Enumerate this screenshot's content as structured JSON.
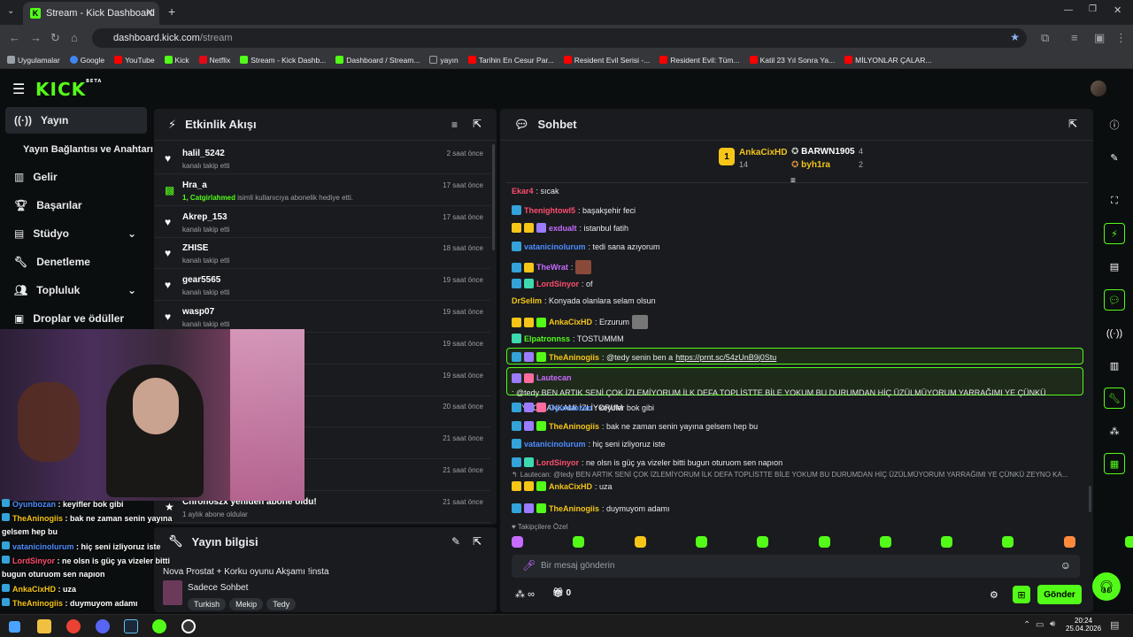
{
  "browser": {
    "tab_title": "Stream - Kick Dashboard",
    "url_host": "dashboard.kick.com",
    "url_path": "/stream",
    "bookmarks": [
      {
        "label": "Uygulamalar",
        "color": "#9aa0a6"
      },
      {
        "label": "Google",
        "color": "#4285f4"
      },
      {
        "label": "YouTube",
        "color": "#ff0000"
      },
      {
        "label": "Kick",
        "color": "#53fc18"
      },
      {
        "label": "Netflix",
        "color": "#e50914"
      },
      {
        "label": "Stream - Kick Dashb...",
        "color": "#53fc18"
      },
      {
        "label": "Dashboard / Stream...",
        "color": "#53fc18"
      },
      {
        "label": "yayın",
        "color": "#9aa0a6"
      },
      {
        "label": "Tarihin En Cesur Par...",
        "color": "#ff0000"
      },
      {
        "label": "Resident Evil Serisi -...",
        "color": "#ff0000"
      },
      {
        "label": "Resident Evil: Tüm...",
        "color": "#ff0000"
      },
      {
        "label": "Katil 23 Yıl Sonra Ya...",
        "color": "#ff0000"
      },
      {
        "label": "MİLYONLAR ÇALAR...",
        "color": "#ff0000"
      }
    ]
  },
  "brand": {
    "logo": "KICK",
    "beta": "BETA",
    "accent": "#53fc18"
  },
  "sidebar": {
    "items": [
      {
        "label": "Yayın",
        "icon": "broadcast-icon"
      },
      {
        "label": "Yayın Bağlantısı ve Anahtarı",
        "icon": ""
      },
      {
        "label": "Gelir",
        "icon": "revenue-icon"
      },
      {
        "label": "Başarılar",
        "icon": "trophy-icon"
      },
      {
        "label": "Stüdyo",
        "icon": "studio-icon"
      },
      {
        "label": "Denetleme",
        "icon": "wrench-icon"
      },
      {
        "label": "Topluluk",
        "icon": "community-icon"
      },
      {
        "label": "Droplar ve ödüller",
        "icon": "drops-icon"
      }
    ]
  },
  "activity": {
    "title": "Etkinlik Akışı",
    "rows": [
      {
        "name": "halil_5242",
        "sub": "kanalı takip etti",
        "time": "2 saat önce",
        "type": "follow"
      },
      {
        "name": "Hra_a",
        "sub_hl": "1, Catgirlahmed",
        "sub": " isimli kullanıcıya abonelik hediye etti.",
        "time": "17 saat önce",
        "type": "gift"
      },
      {
        "name": "Akrep_153",
        "sub": "kanalı takip etti",
        "time": "17 saat önce",
        "type": "follow"
      },
      {
        "name": "ZHISE",
        "sub": "kanalı takip etti",
        "time": "18 saat önce",
        "type": "follow"
      },
      {
        "name": "gear5565",
        "sub": "kanalı takip etti",
        "time": "19 saat önce",
        "type": "follow"
      },
      {
        "name": "wasp07",
        "sub": "kanalı takip etti",
        "time": "19 saat önce",
        "type": "follow"
      },
      {
        "name": "",
        "sub": "enelik hediye etti.",
        "time": "19 saat önce",
        "type": "gift"
      },
      {
        "name": "",
        "sub": "",
        "time": "19 saat önce",
        "type": "follow"
      },
      {
        "name": "",
        "sub": "",
        "time": "20 saat önce",
        "type": "follow"
      },
      {
        "name": "one oldu!",
        "sub": "",
        "time": "21 saat önce",
        "type": "sub"
      },
      {
        "name": "",
        "sub": "",
        "time": "21 saat önce",
        "type": "sub"
      },
      {
        "name": "Chronoszx yeniden abone oldu!",
        "sub": "1 aylık abone oldular",
        "time": "21 saat önce",
        "type": "sub"
      }
    ]
  },
  "stream_info": {
    "title": "Yayın bilgisi",
    "stream_title": "Nova Prostat + Korku oyunu Akşamı !insta",
    "category": "Sadece Sohbet",
    "tags": [
      "Turkish",
      "Mekip",
      "Tedy"
    ]
  },
  "chat": {
    "title": "Sohbet",
    "leaderboard": [
      {
        "name": "AnkaCixHD",
        "count": "14",
        "rank": "1"
      },
      {
        "name": "BARWN1905",
        "count": "4"
      },
      {
        "name": "byh1ra",
        "count": "2"
      }
    ],
    "messages": [
      {
        "user": "Ekar4",
        "color": "#ff4d6d",
        "text": ": sıcak",
        "badges": []
      },
      {
        "user": "Thenightowl5",
        "color": "#ff4d6d",
        "text": ": başakşehir feci",
        "badges": [
          "#33a3d9"
        ]
      },
      {
        "user": "exdualt",
        "color": "#c86bff",
        "text": ": istanbul fatih",
        "badges": [
          "#f5c518",
          "#f5c518",
          "#9b7cff"
        ]
      },
      {
        "user": "vatanicinolurum",
        "color": "#4f8cff",
        "text": ": tedi sana azıyorum",
        "badges": [
          "#33a3d9"
        ]
      },
      {
        "user": "TheWrat",
        "color": "#c86bff",
        "text": ":",
        "badges": [
          "#33a3d9",
          "#f5c518"
        ]
      },
      {
        "user": "LordSinyor",
        "color": "#ff4d6d",
        "text": ": of",
        "badges": [
          "#33a3d9",
          "#3fd9b0"
        ]
      },
      {
        "user": "DrSelim",
        "color": "#f5c518",
        "text": ": Konyada olanlara selam olsun",
        "badges": []
      },
      {
        "user": "AnkaCixHD",
        "color": "#f5c518",
        "text": ": Erzurum",
        "badges": [
          "#f5c518",
          "#f5c518",
          "#53fc18"
        ]
      },
      {
        "user": "Elpatronnss",
        "color": "#53fc18",
        "text": ": TOSTUMMM",
        "badges": [
          "#3fd9b0"
        ]
      },
      {
        "user": "TheAninogiis",
        "color": "#f5c518",
        "text": ": @tedy senin ben a ",
        "link": "https://prnt.sc/54zUnB9j0Stu",
        "badges": [
          "#33a3d9",
          "#9b7cff",
          "#53fc18"
        ]
      },
      {
        "user": "Lautecan",
        "color": "#c86bff",
        "text": ": @tedy BEN ARTIK SENİ ÇOK İZLEMİYORUM İLK DEFA TOPLİSTTE BİLE YOKUM BU DURUMDAN HİÇ ÜZÜLMÜYORUM YARRAĞIMI YE ÇÜNKÜ",
        "text2": "ZEYNO KANKAMI İZLİYORUM",
        "badges": [
          "#9b7cff",
          "#ff6b9e"
        ]
      },
      {
        "user": "Oyunbozan",
        "color": "#4f8cff",
        "text": ": keyifler bok gibi",
        "badges": [
          "#33a3d9",
          "#9b7cff",
          "#ff6b9e"
        ]
      },
      {
        "user": "TheAninogiis",
        "color": "#f5c518",
        "text": ": bak ne zaman senin yayına gelsem hep bu",
        "badges": [
          "#33a3d9",
          "#9b7cff",
          "#53fc18"
        ]
      },
      {
        "user": "vatanicinolurum",
        "color": "#4f8cff",
        "text": ": hiç seni izliyoruz iste",
        "badges": [
          "#33a3d9"
        ]
      },
      {
        "user": "LordSinyor",
        "color": "#ff4d6d",
        "text": ": ne olsn is güç ya vizeler bitti bugun oturuom sen napıon",
        "badges": [
          "#33a3d9",
          "#3fd9b0"
        ]
      },
      {
        "reply": "Lautecan: @tedy BEN ARTIK SENİ ÇOK İZLEMİYORUM İLK DEFA TOPLİSTTE BİLE YOKUM BU DURUMDAN HİÇ ÜZÜLMÜYORUM YARRAĞIMI YE ÇÜNKÜ ZEYNO KA...",
        "user": "AnkaCixHD",
        "color": "#f5c518",
        "text": ": uza",
        "badges": [
          "#f5c518",
          "#f5c518",
          "#53fc18"
        ]
      },
      {
        "user": "TheAninogiis",
        "color": "#f5c518",
        "text": ": duymuyom adamı",
        "badges": [
          "#33a3d9",
          "#9b7cff",
          "#53fc18"
        ]
      }
    ],
    "emote_label": "Takipçilere Özel",
    "input_placeholder": "Bir mesaj gönderin",
    "points_label": "∞",
    "points_count": "0",
    "send_label": "Gönder"
  },
  "overlay": {
    "lines": [
      {
        "user": "Oyunbozan",
        "color": "#4f8cff",
        "text": " : keyifler bok gibi"
      },
      {
        "user": "TheAninogiis",
        "color": "#f5c518",
        "text": " : bak ne zaman senin yayına"
      },
      {
        "user": "",
        "color": "#fff",
        "text": "gelsem hep bu"
      },
      {
        "user": "vatanicinolurum",
        "color": "#4f8cff",
        "text": " : hiç seni izliyoruz iste"
      },
      {
        "user": "LordSinyor",
        "color": "#ff4d6d",
        "text": " : ne olsn is güç ya vizeler bitti"
      },
      {
        "user": "",
        "color": "#fff",
        "text": "bugun oturuom sen napıon"
      },
      {
        "user": "AnkaCixHD",
        "color": "#f5c518",
        "text": " : uza"
      },
      {
        "user": "TheAninogiis",
        "color": "#f5c518",
        "text": " : duymuyom adamı"
      }
    ]
  },
  "taskbar": {
    "time": "20:24",
    "date": "25.04.2026"
  }
}
